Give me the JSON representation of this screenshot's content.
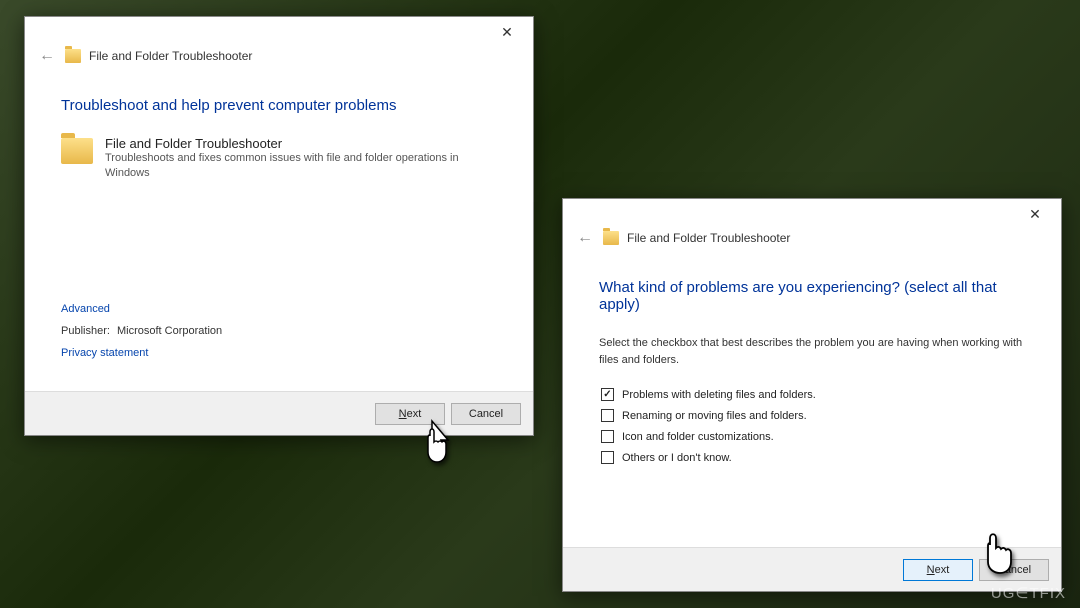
{
  "dialog1": {
    "window_title": "File and Folder Troubleshooter",
    "heading": "Troubleshoot and help prevent computer problems",
    "item_title": "File and Folder Troubleshooter",
    "item_desc": "Troubleshoots and fixes common issues with file and folder operations in Windows",
    "advanced_link": "Advanced",
    "publisher_label": "Publisher:",
    "publisher_value": "Microsoft Corporation",
    "privacy_link": "Privacy statement",
    "next_label_pre": "N",
    "next_label_rest": "ext",
    "cancel_label": "Cancel"
  },
  "dialog2": {
    "window_title": "File and Folder Troubleshooter",
    "heading": "What kind of problems are you experiencing? (select all that apply)",
    "instruction": "Select the checkbox that best describes the problem you are having when working with files and folders.",
    "options": [
      {
        "label": "Problems with deleting files and folders.",
        "checked": true
      },
      {
        "label": "Renaming or moving files and folders.",
        "checked": false
      },
      {
        "label": "Icon and folder customizations.",
        "checked": false
      },
      {
        "label": "Others or I don't know.",
        "checked": false
      }
    ],
    "next_label_pre": "N",
    "next_label_rest": "ext",
    "cancel_label": "Cancel"
  },
  "watermark": "UG∈TFIX"
}
